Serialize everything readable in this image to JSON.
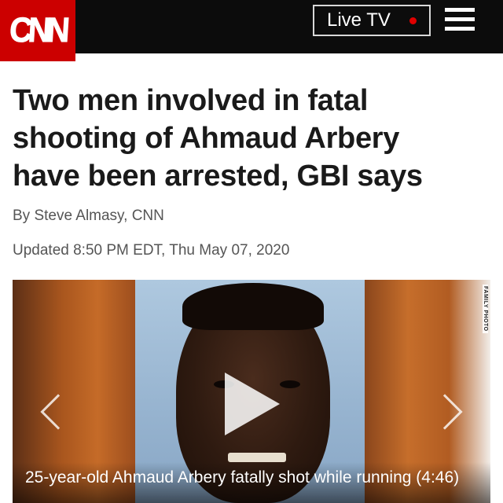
{
  "header": {
    "logo_text": "CNN",
    "live_label": "Live TV",
    "logo_color": "#cc0000",
    "live_dot_color": "#e00000"
  },
  "article": {
    "headline_lines": [
      "Two men involved in fatal",
      "shooting of Ahmaud Arbery",
      "have been arrested, GBI says"
    ],
    "byline_prefix": "By ",
    "author": "Steve Almasy, CNN",
    "updated": "Updated 8:50 PM EDT, Thu May 07, 2020"
  },
  "video": {
    "caption": "25-year-old Ahmaud Arbery fatally shot while running (4:46)",
    "photo_credit": "FAMILY PHOTO",
    "icons": [
      "play-icon",
      "chevron-left-icon",
      "chevron-right-icon"
    ]
  }
}
